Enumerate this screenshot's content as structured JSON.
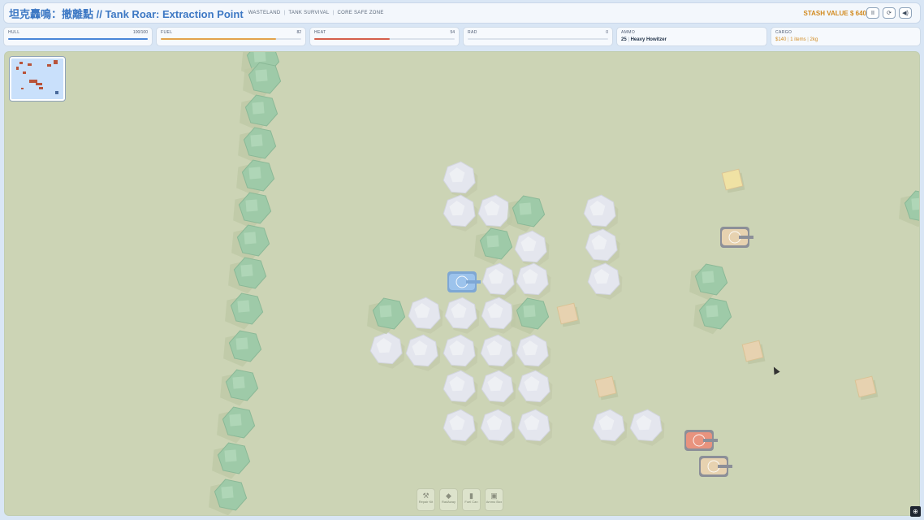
{
  "header": {
    "title": "坦克轟鳴：撤離點 // Tank Roar: Extraction Point",
    "tags": [
      "WASTELAND",
      "TANK SURVIVAL",
      "CORE SAFE ZONE"
    ],
    "stash_label": "STASH VALUE $ 640",
    "buttons": [
      "II",
      "⟳",
      "◀)"
    ]
  },
  "stats": {
    "hull": {
      "label": "HULL",
      "value": "100/100",
      "level": 1.0,
      "color": "#4a86d8"
    },
    "fuel": {
      "label": "FUEL",
      "value": "82",
      "level": 0.82,
      "color": "#e3a24b"
    },
    "heat": {
      "label": "HEAT",
      "value": "54",
      "level": 0.54,
      "color": "#d45e4a"
    },
    "rad": {
      "label": "RAD",
      "value": "0",
      "level": 0.0,
      "color": "#8a9ab0"
    },
    "ammo": {
      "label": "AMMO",
      "count": "25",
      "weapon": "Heavy Howitzer"
    },
    "cargo": {
      "label": "CARGO",
      "money": "$140",
      "items": "1 items",
      "weight": "2kg"
    }
  },
  "toolbar": [
    {
      "icon": "wrench-icon",
      "glyph": "⚒",
      "label": "Repair Kit"
    },
    {
      "icon": "radaway-icon",
      "glyph": "◆",
      "label": "RadAway"
    },
    {
      "icon": "fuel-can-icon",
      "glyph": "▮",
      "label": "Fuel Can"
    },
    {
      "icon": "ammo-box-icon",
      "glyph": "▣",
      "label": "Ammo Box"
    }
  ],
  "corner_icon": "zoom-icon",
  "colors": {
    "ground": "#ccd4b5",
    "rock": "#e4e6ee",
    "tree": "#9ecaa8",
    "player_tank": "#9cc3ec",
    "enemy_tank": "#e8937e",
    "wreck": "#e7d2b0",
    "crate": "#f0e2a4"
  }
}
